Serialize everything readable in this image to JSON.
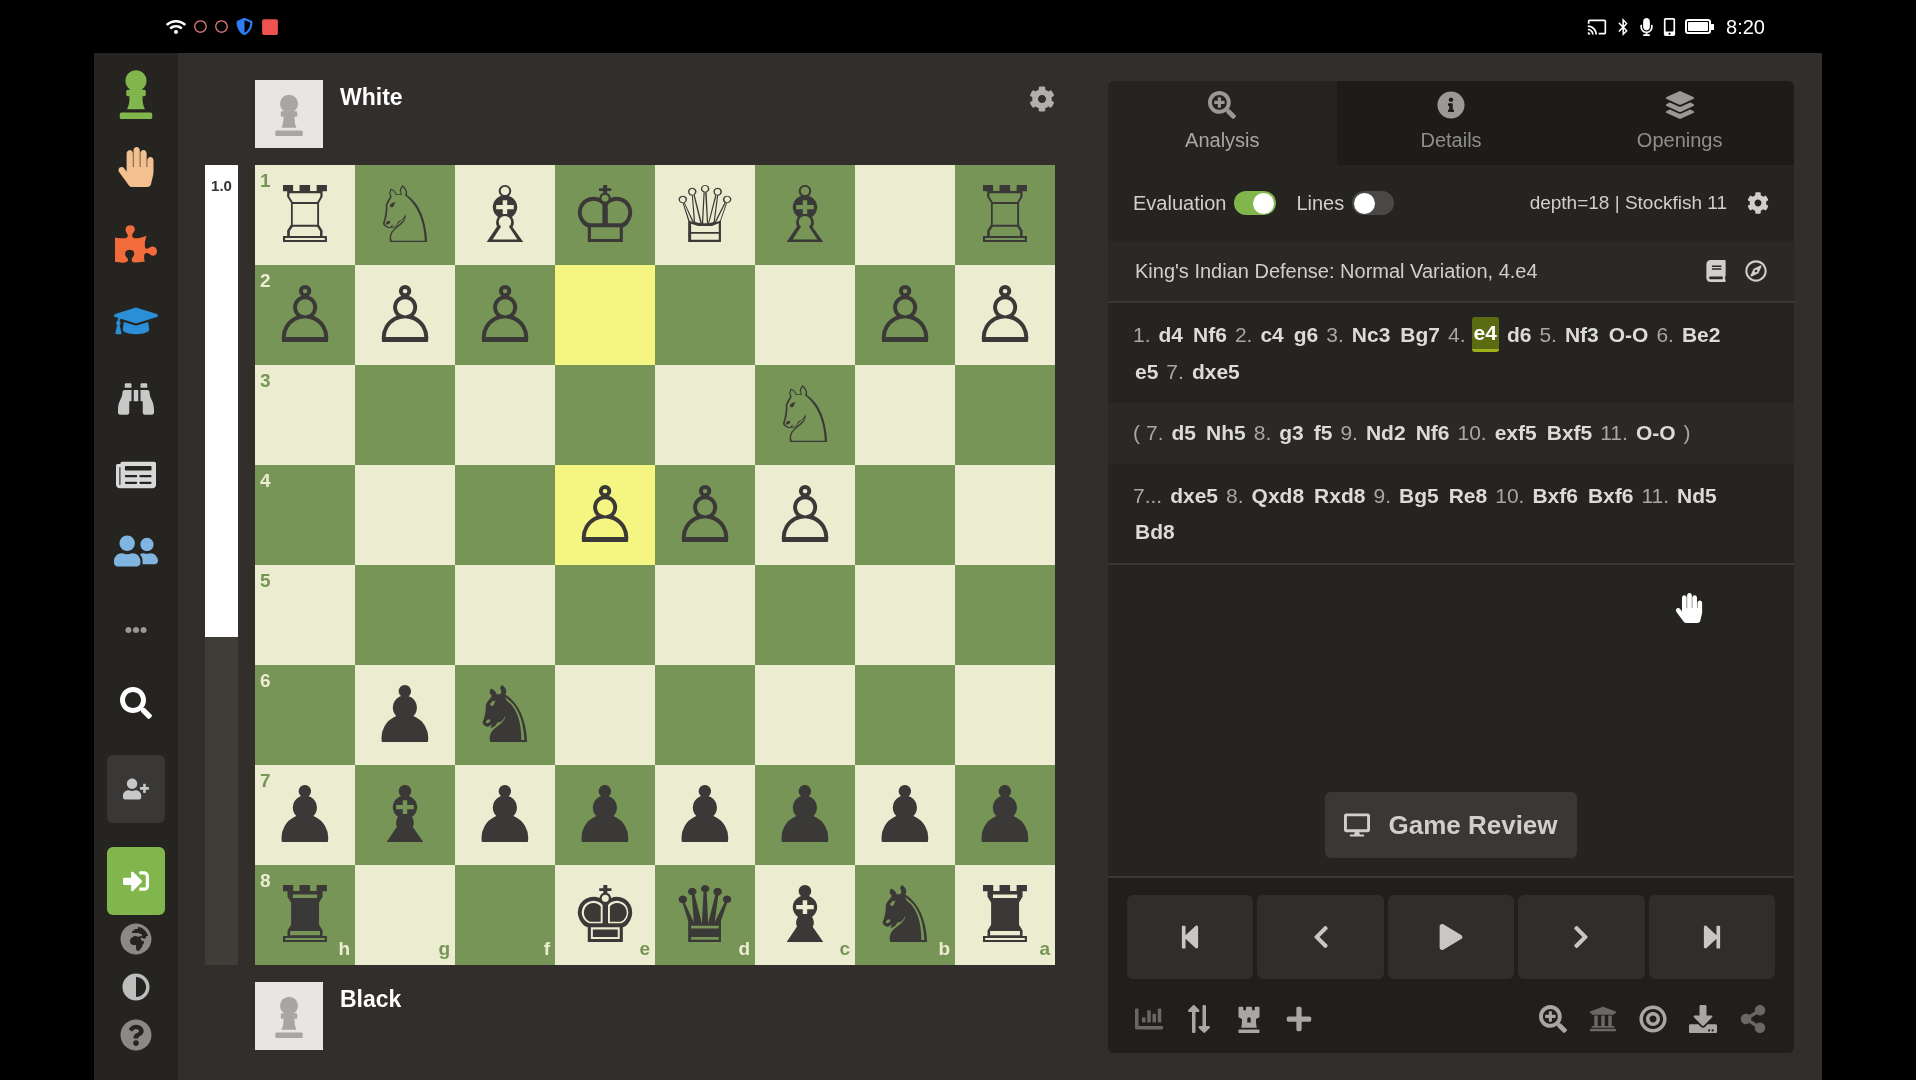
{
  "status_bar": {
    "time": "8:20"
  },
  "top_player": {
    "name": "White"
  },
  "bottom_player": {
    "name": "Black"
  },
  "eval_bar": {
    "score": "1.0",
    "level": 0.59
  },
  "board": {
    "files": [
      "h",
      "g",
      "f",
      "e",
      "d",
      "c",
      "b",
      "a"
    ],
    "ranks": [
      {
        "label": "1",
        "squares": [
          {
            "piece": "♖",
            "highlighted": false
          },
          {
            "piece": "♘",
            "highlighted": false
          },
          {
            "piece": "♗",
            "highlighted": false
          },
          {
            "piece": "♔",
            "highlighted": false
          },
          {
            "piece": "♕",
            "highlighted": false
          },
          {
            "piece": "♗",
            "highlighted": false
          },
          {
            "highlighted": false
          },
          {
            "piece": "♖",
            "highlighted": false
          }
        ]
      },
      {
        "label": "2",
        "squares": [
          {
            "piece": "♙",
            "highlighted": false
          },
          {
            "piece": "♙",
            "highlighted": false
          },
          {
            "piece": "♙",
            "highlighted": false
          },
          {
            "highlighted": true
          },
          {
            "highlighted": false
          },
          {
            "highlighted": false
          },
          {
            "piece": "♙",
            "highlighted": false
          },
          {
            "piece": "♙",
            "highlighted": false
          }
        ]
      },
      {
        "label": "3",
        "squares": [
          {
            "highlighted": false
          },
          {
            "highlighted": false
          },
          {
            "highlighted": false
          },
          {
            "highlighted": false
          },
          {
            "highlighted": false
          },
          {
            "piece": "♘",
            "highlighted": false
          },
          {
            "highlighted": false
          },
          {
            "highlighted": false
          }
        ]
      },
      {
        "label": "4",
        "squares": [
          {
            "highlighted": false
          },
          {
            "highlighted": false
          },
          {
            "highlighted": false
          },
          {
            "piece": "♙",
            "highlighted": true
          },
          {
            "piece": "♙",
            "highlighted": false
          },
          {
            "piece": "♙",
            "highlighted": false
          },
          {
            "highlighted": false
          },
          {
            "highlighted": false
          }
        ]
      },
      {
        "label": "5",
        "squares": [
          {
            "highlighted": false
          },
          {
            "highlighted": false
          },
          {
            "highlighted": false
          },
          {
            "highlighted": false
          },
          {
            "highlighted": false
          },
          {
            "highlighted": false
          },
          {
            "highlighted": false
          },
          {
            "highlighted": false
          }
        ]
      },
      {
        "label": "6",
        "squares": [
          {
            "highlighted": false
          },
          {
            "piece": "♟",
            "highlighted": false
          },
          {
            "piece": "♞",
            "highlighted": false
          },
          {
            "highlighted": false
          },
          {
            "highlighted": false
          },
          {
            "highlighted": false
          },
          {
            "highlighted": false
          },
          {
            "highlighted": false
          }
        ]
      },
      {
        "label": "7",
        "squares": [
          {
            "piece": "♟",
            "highlighted": false
          },
          {
            "piece": "♝",
            "highlighted": false
          },
          {
            "piece": "♟",
            "highlighted": false
          },
          {
            "piece": "♟",
            "highlighted": false
          },
          {
            "piece": "♟",
            "highlighted": false
          },
          {
            "piece": "♟",
            "highlighted": false
          },
          {
            "piece": "♟",
            "highlighted": false
          },
          {
            "piece": "♟",
            "highlighted": false
          }
        ]
      },
      {
        "label": "8",
        "squares": [
          {
            "piece": "♜",
            "highlighted": false
          },
          {
            "highlighted": false
          },
          {
            "highlighted": false
          },
          {
            "piece": "♚",
            "highlighted": false
          },
          {
            "piece": "♛",
            "highlighted": false
          },
          {
            "piece": "♝",
            "highlighted": false
          },
          {
            "piece": "♞",
            "highlighted": false
          },
          {
            "piece": "♜",
            "highlighted": false
          }
        ]
      }
    ]
  },
  "tabs": [
    {
      "label": "Analysis",
      "selected": true
    },
    {
      "label": "Details",
      "selected": false
    },
    {
      "label": "Openings",
      "selected": false
    }
  ],
  "toggles": [
    {
      "label": "Evaluation",
      "on": true
    },
    {
      "label": "Lines",
      "on": false
    }
  ],
  "engine": "depth=18 | Stockfish 11",
  "opening": "King's Indian Defense: Normal Variation, 4.e4",
  "move_lines": [
    {
      "kind": "mainline",
      "tokens": [
        {
          "kind": "num",
          "text": "1."
        },
        {
          "kind": "move",
          "text": "d4",
          "selected": false
        },
        {
          "kind": "move",
          "text": "Nf6",
          "selected": false
        },
        {
          "kind": "num",
          "text": "2."
        },
        {
          "kind": "move",
          "text": "c4",
          "selected": false
        },
        {
          "kind": "move",
          "text": "g6",
          "selected": false
        },
        {
          "kind": "num",
          "text": "3."
        },
        {
          "kind": "move",
          "text": "Nc3",
          "selected": false
        },
        {
          "kind": "move",
          "text": "Bg7",
          "selected": false
        },
        {
          "kind": "num",
          "text": "4."
        },
        {
          "kind": "move",
          "text": "e4",
          "selected": true
        },
        {
          "kind": "move",
          "text": "d6",
          "selected": false
        },
        {
          "kind": "num",
          "text": "5."
        },
        {
          "kind": "move",
          "text": "Nf3",
          "selected": false
        },
        {
          "kind": "move",
          "text": "O-O",
          "selected": false
        },
        {
          "kind": "num",
          "text": "6."
        },
        {
          "kind": "move",
          "text": "Be2",
          "selected": false
        },
        {
          "kind": "move",
          "text": "e5",
          "selected": false
        },
        {
          "kind": "num",
          "text": "7."
        },
        {
          "kind": "move",
          "text": "dxe5",
          "selected": false
        }
      ]
    },
    {
      "kind": "variation",
      "tokens": [
        {
          "kind": "num",
          "text": "("
        },
        {
          "kind": "num",
          "text": "7."
        },
        {
          "kind": "move",
          "text": "d5",
          "selected": false
        },
        {
          "kind": "move",
          "text": "Nh5",
          "selected": false
        },
        {
          "kind": "num",
          "text": "8."
        },
        {
          "kind": "move",
          "text": "g3",
          "selected": false
        },
        {
          "kind": "move",
          "text": "f5",
          "selected": false
        },
        {
          "kind": "num",
          "text": "9."
        },
        {
          "kind": "move",
          "text": "Nd2",
          "selected": false
        },
        {
          "kind": "move",
          "text": "Nf6",
          "selected": false
        },
        {
          "kind": "num",
          "text": "10."
        },
        {
          "kind": "move",
          "text": "exf5",
          "selected": false
        },
        {
          "kind": "move",
          "text": "Bxf5",
          "selected": false
        },
        {
          "kind": "num",
          "text": "11."
        },
        {
          "kind": "move",
          "text": "O-O",
          "selected": false
        },
        {
          "kind": "num",
          "text": ")"
        }
      ]
    },
    {
      "kind": "line",
      "tokens": [
        {
          "kind": "num",
          "text": "7..."
        },
        {
          "kind": "move",
          "text": "dxe5",
          "selected": false
        },
        {
          "kind": "num",
          "text": "8."
        },
        {
          "kind": "move",
          "text": "Qxd8",
          "selected": false
        },
        {
          "kind": "move",
          "text": "Rxd8",
          "selected": false
        },
        {
          "kind": "num",
          "text": "9."
        },
        {
          "kind": "move",
          "text": "Bg5",
          "selected": false
        },
        {
          "kind": "move",
          "text": "Re8",
          "selected": false
        },
        {
          "kind": "num",
          "text": "10."
        },
        {
          "kind": "move",
          "text": "Bxf6",
          "selected": false
        },
        {
          "kind": "move",
          "text": "Bxf6",
          "selected": false
        },
        {
          "kind": "num",
          "text": "11."
        },
        {
          "kind": "move",
          "text": "Nd5",
          "selected": false
        },
        {
          "kind": "move",
          "text": "Bd8",
          "selected": false
        }
      ]
    }
  ],
  "review_button": "Game Review"
}
